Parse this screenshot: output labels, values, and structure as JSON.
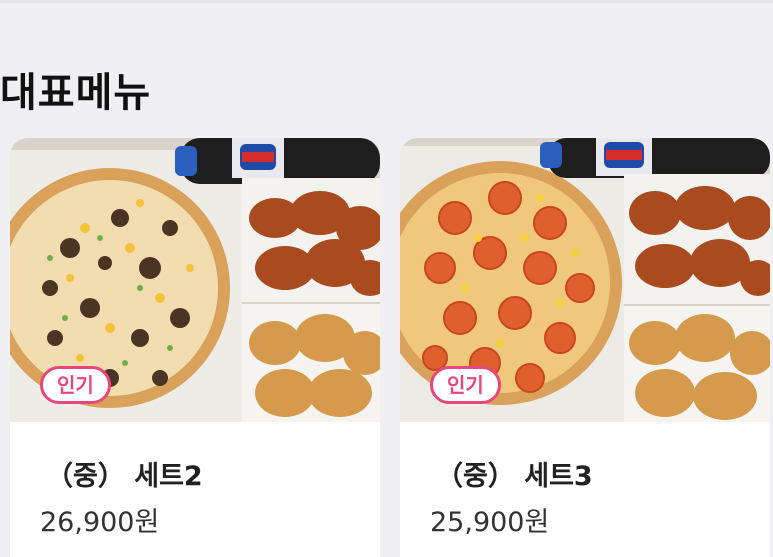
{
  "section": {
    "title": "대표메뉴"
  },
  "menu_items": [
    {
      "badge": "인기",
      "name": "（중） 세트2",
      "price": "26,900원",
      "image_alt": "pizza-chicken-set-image"
    },
    {
      "badge": "인기",
      "name": "（중） 세트3",
      "price": "25,900원",
      "image_alt": "pizza-chicken-set-image"
    }
  ],
  "colors": {
    "badge": "#e8467c",
    "background": "#f0f0f2",
    "card": "#ffffff"
  }
}
